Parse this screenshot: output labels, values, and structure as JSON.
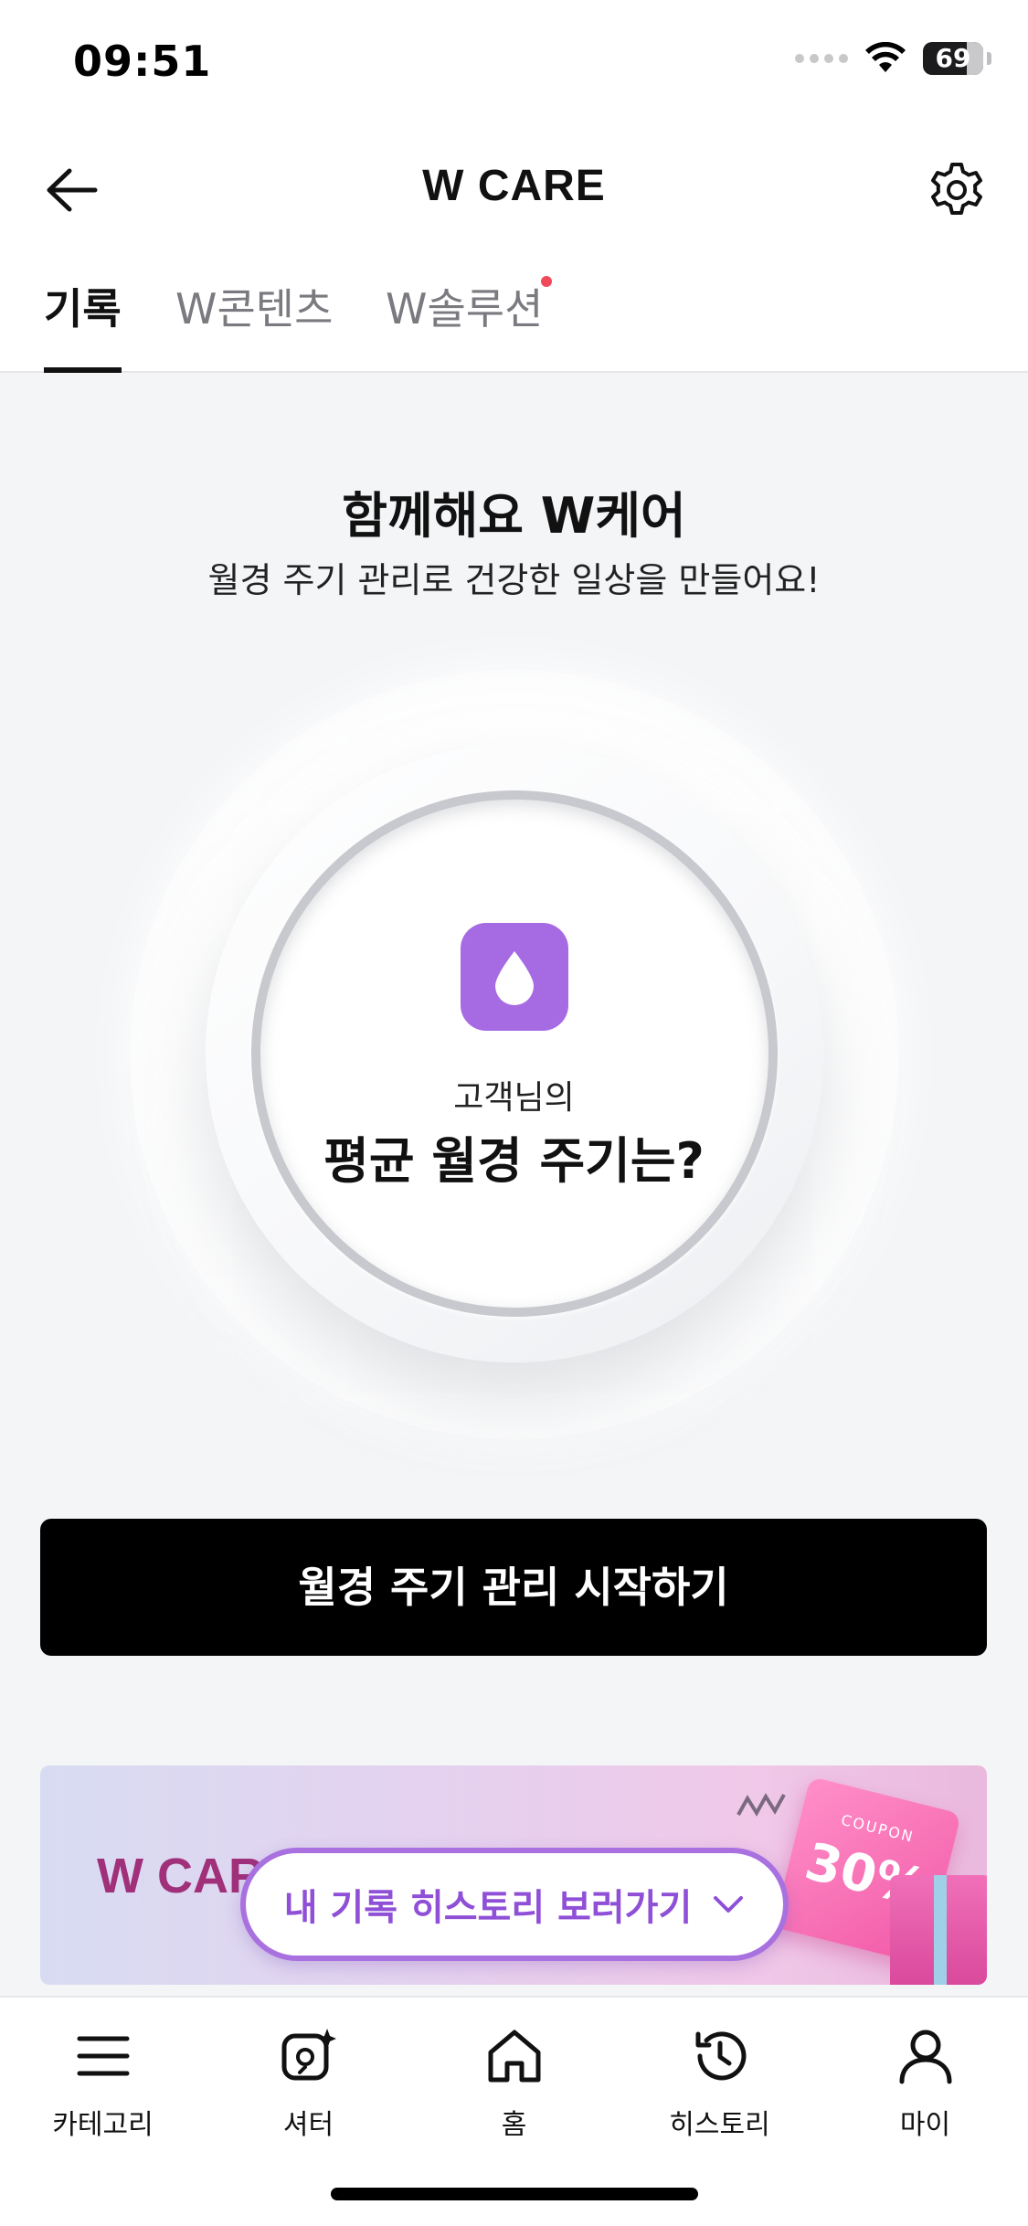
{
  "status_bar": {
    "time": "09:51",
    "battery": "69"
  },
  "header": {
    "title": "W CARE"
  },
  "tabs": [
    {
      "label": "기록",
      "active": true
    },
    {
      "label": "W콘텐츠",
      "active": false
    },
    {
      "label": "W솔루션",
      "active": false,
      "has_dot": true
    }
  ],
  "hero": {
    "title": "함께해요 W케어",
    "subtitle": "월경 주기 관리로 건강한 일상을 만들어요!"
  },
  "circle": {
    "small_text": "고객님의",
    "big_text": "평균 월경 주기는?",
    "icon": "drop-icon"
  },
  "cta": {
    "label": "월경 주기 관리 시작하기"
  },
  "banner": {
    "title": "W CARE",
    "coupon_label": "COUPON",
    "coupon_value": "30%"
  },
  "floating_pill": {
    "label": "내 기록 히스토리 보러가기"
  },
  "bottom_nav": [
    {
      "label": "카테고리",
      "icon": "menu-icon"
    },
    {
      "label": "셔터",
      "icon": "shutter-icon"
    },
    {
      "label": "홈",
      "icon": "home-icon"
    },
    {
      "label": "히스토리",
      "icon": "history-icon"
    },
    {
      "label": "마이",
      "icon": "user-icon"
    }
  ],
  "colors": {
    "accent": "#a66be3",
    "pill_border": "#a971e0",
    "cta_bg": "#000000",
    "tab_dot": "#f04a5a"
  }
}
